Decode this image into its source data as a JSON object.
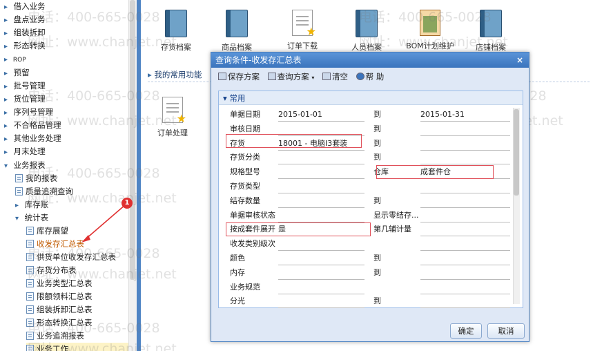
{
  "sidebar": {
    "items": [
      {
        "label": "借入业务",
        "toggle": "▸"
      },
      {
        "label": "盘点业务",
        "toggle": "▸"
      },
      {
        "label": "组装拆卸",
        "toggle": "▸"
      },
      {
        "label": "形态转换",
        "toggle": "▸"
      },
      {
        "label": "ROP",
        "toggle": "▸"
      },
      {
        "label": "预留",
        "toggle": "▸"
      },
      {
        "label": "批号管理",
        "toggle": "▸"
      },
      {
        "label": "货位管理",
        "toggle": "▸"
      },
      {
        "label": "序列号管理",
        "toggle": "▸"
      },
      {
        "label": "不合格品管理",
        "toggle": "▸"
      },
      {
        "label": "其他业务处理",
        "toggle": "▸"
      },
      {
        "label": "月末处理",
        "toggle": "▸"
      },
      {
        "label": "业务报表",
        "toggle": "▾"
      },
      {
        "label": "我的报表"
      },
      {
        "label": "质量追溯查询"
      },
      {
        "label": "库存账",
        "toggle": "▸"
      },
      {
        "label": "统计表",
        "toggle": "▾"
      },
      {
        "label": "库存展望"
      },
      {
        "label": "收发存汇总表"
      },
      {
        "label": "供货单位收发存汇总表"
      },
      {
        "label": "存货分布表"
      },
      {
        "label": "业务类型汇总表"
      },
      {
        "label": "限额领料汇总表"
      },
      {
        "label": "组装拆卸汇总表"
      },
      {
        "label": "形态转换汇总表"
      },
      {
        "label": "业务追溯报表"
      },
      {
        "label": "业务工作"
      }
    ]
  },
  "desktop": {
    "icons": [
      "存货档案",
      "商品档案",
      "订单下载",
      "人员档案",
      "BOM计划维护",
      "店铺档案"
    ],
    "favorites_label": "我的常用功能",
    "order_label": "订单处理"
  },
  "watermark": {
    "phone": "电话：400-665-0028",
    "site": "网址：www.chanjet.net"
  },
  "dialog": {
    "title": "查询条件-收发存汇总表",
    "close": "×",
    "toolbar": {
      "save": "保存方案",
      "query": "查询方案",
      "clear": "清空",
      "help": "帮 助"
    },
    "section": "常用",
    "left_rows": [
      {
        "label": "单据日期",
        "value": "2015-01-01"
      },
      {
        "label": "审核日期",
        "value": ""
      },
      {
        "label": "存货",
        "value": "18001 - 电脑I3套装"
      },
      {
        "label": "存货分类",
        "value": ""
      },
      {
        "label": "规格型号",
        "value": ""
      },
      {
        "label": "存货类型",
        "value": ""
      },
      {
        "label": "结存数量",
        "value": ""
      },
      {
        "label": "单据审核状态",
        "value": ""
      },
      {
        "label": "按成套件展开",
        "value": "是"
      },
      {
        "label": "收发类别级次",
        "value": ""
      },
      {
        "label": "颜色",
        "value": ""
      },
      {
        "label": "内存",
        "value": ""
      },
      {
        "label": "业务规范",
        "value": ""
      },
      {
        "label": "分光",
        "value": ""
      }
    ],
    "right_rows": [
      {
        "label": "到",
        "value": "2015-01-31"
      },
      {
        "label": "到",
        "value": ""
      },
      {
        "label": "到",
        "value": ""
      },
      {
        "label": "到",
        "value": ""
      },
      {
        "label": "仓库",
        "value": "成套件仓"
      },
      {
        "label": "",
        "value": ""
      },
      {
        "label": "到",
        "value": ""
      },
      {
        "label": "显示零结存...",
        "value": ""
      },
      {
        "label": "第几辅计量",
        "value": ""
      },
      {
        "label": "",
        "value": ""
      },
      {
        "label": "到",
        "value": ""
      },
      {
        "label": "到",
        "value": ""
      },
      {
        "label": "",
        "value": ""
      },
      {
        "label": "到",
        "value": ""
      }
    ],
    "ok": "确定",
    "cancel": "取消"
  },
  "annotation": {
    "badge": "1"
  },
  "colors": {
    "accent": "#4f84c4",
    "highlight": "#e0505a",
    "selected": "#c05a00"
  }
}
